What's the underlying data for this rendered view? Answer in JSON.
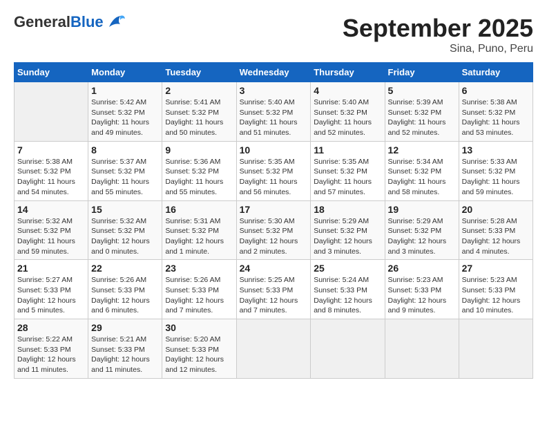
{
  "header": {
    "logo_general": "General",
    "logo_blue": "Blue",
    "month_title": "September 2025",
    "subtitle": "Sina, Puno, Peru"
  },
  "days_of_week": [
    "Sunday",
    "Monday",
    "Tuesday",
    "Wednesday",
    "Thursday",
    "Friday",
    "Saturday"
  ],
  "weeks": [
    [
      {
        "day": "",
        "info": ""
      },
      {
        "day": "1",
        "info": "Sunrise: 5:42 AM\nSunset: 5:32 PM\nDaylight: 11 hours\nand 49 minutes."
      },
      {
        "day": "2",
        "info": "Sunrise: 5:41 AM\nSunset: 5:32 PM\nDaylight: 11 hours\nand 50 minutes."
      },
      {
        "day": "3",
        "info": "Sunrise: 5:40 AM\nSunset: 5:32 PM\nDaylight: 11 hours\nand 51 minutes."
      },
      {
        "day": "4",
        "info": "Sunrise: 5:40 AM\nSunset: 5:32 PM\nDaylight: 11 hours\nand 52 minutes."
      },
      {
        "day": "5",
        "info": "Sunrise: 5:39 AM\nSunset: 5:32 PM\nDaylight: 11 hours\nand 52 minutes."
      },
      {
        "day": "6",
        "info": "Sunrise: 5:38 AM\nSunset: 5:32 PM\nDaylight: 11 hours\nand 53 minutes."
      }
    ],
    [
      {
        "day": "7",
        "info": "Sunrise: 5:38 AM\nSunset: 5:32 PM\nDaylight: 11 hours\nand 54 minutes."
      },
      {
        "day": "8",
        "info": "Sunrise: 5:37 AM\nSunset: 5:32 PM\nDaylight: 11 hours\nand 55 minutes."
      },
      {
        "day": "9",
        "info": "Sunrise: 5:36 AM\nSunset: 5:32 PM\nDaylight: 11 hours\nand 55 minutes."
      },
      {
        "day": "10",
        "info": "Sunrise: 5:35 AM\nSunset: 5:32 PM\nDaylight: 11 hours\nand 56 minutes."
      },
      {
        "day": "11",
        "info": "Sunrise: 5:35 AM\nSunset: 5:32 PM\nDaylight: 11 hours\nand 57 minutes."
      },
      {
        "day": "12",
        "info": "Sunrise: 5:34 AM\nSunset: 5:32 PM\nDaylight: 11 hours\nand 58 minutes."
      },
      {
        "day": "13",
        "info": "Sunrise: 5:33 AM\nSunset: 5:32 PM\nDaylight: 11 hours\nand 59 minutes."
      }
    ],
    [
      {
        "day": "14",
        "info": "Sunrise: 5:32 AM\nSunset: 5:32 PM\nDaylight: 11 hours\nand 59 minutes."
      },
      {
        "day": "15",
        "info": "Sunrise: 5:32 AM\nSunset: 5:32 PM\nDaylight: 12 hours\nand 0 minutes."
      },
      {
        "day": "16",
        "info": "Sunrise: 5:31 AM\nSunset: 5:32 PM\nDaylight: 12 hours\nand 1 minute."
      },
      {
        "day": "17",
        "info": "Sunrise: 5:30 AM\nSunset: 5:32 PM\nDaylight: 12 hours\nand 2 minutes."
      },
      {
        "day": "18",
        "info": "Sunrise: 5:29 AM\nSunset: 5:32 PM\nDaylight: 12 hours\nand 3 minutes."
      },
      {
        "day": "19",
        "info": "Sunrise: 5:29 AM\nSunset: 5:32 PM\nDaylight: 12 hours\nand 3 minutes."
      },
      {
        "day": "20",
        "info": "Sunrise: 5:28 AM\nSunset: 5:33 PM\nDaylight: 12 hours\nand 4 minutes."
      }
    ],
    [
      {
        "day": "21",
        "info": "Sunrise: 5:27 AM\nSunset: 5:33 PM\nDaylight: 12 hours\nand 5 minutes."
      },
      {
        "day": "22",
        "info": "Sunrise: 5:26 AM\nSunset: 5:33 PM\nDaylight: 12 hours\nand 6 minutes."
      },
      {
        "day": "23",
        "info": "Sunrise: 5:26 AM\nSunset: 5:33 PM\nDaylight: 12 hours\nand 7 minutes."
      },
      {
        "day": "24",
        "info": "Sunrise: 5:25 AM\nSunset: 5:33 PM\nDaylight: 12 hours\nand 7 minutes."
      },
      {
        "day": "25",
        "info": "Sunrise: 5:24 AM\nSunset: 5:33 PM\nDaylight: 12 hours\nand 8 minutes."
      },
      {
        "day": "26",
        "info": "Sunrise: 5:23 AM\nSunset: 5:33 PM\nDaylight: 12 hours\nand 9 minutes."
      },
      {
        "day": "27",
        "info": "Sunrise: 5:23 AM\nSunset: 5:33 PM\nDaylight: 12 hours\nand 10 minutes."
      }
    ],
    [
      {
        "day": "28",
        "info": "Sunrise: 5:22 AM\nSunset: 5:33 PM\nDaylight: 12 hours\nand 11 minutes."
      },
      {
        "day": "29",
        "info": "Sunrise: 5:21 AM\nSunset: 5:33 PM\nDaylight: 12 hours\nand 11 minutes."
      },
      {
        "day": "30",
        "info": "Sunrise: 5:20 AM\nSunset: 5:33 PM\nDaylight: 12 hours\nand 12 minutes."
      },
      {
        "day": "",
        "info": ""
      },
      {
        "day": "",
        "info": ""
      },
      {
        "day": "",
        "info": ""
      },
      {
        "day": "",
        "info": ""
      }
    ]
  ]
}
